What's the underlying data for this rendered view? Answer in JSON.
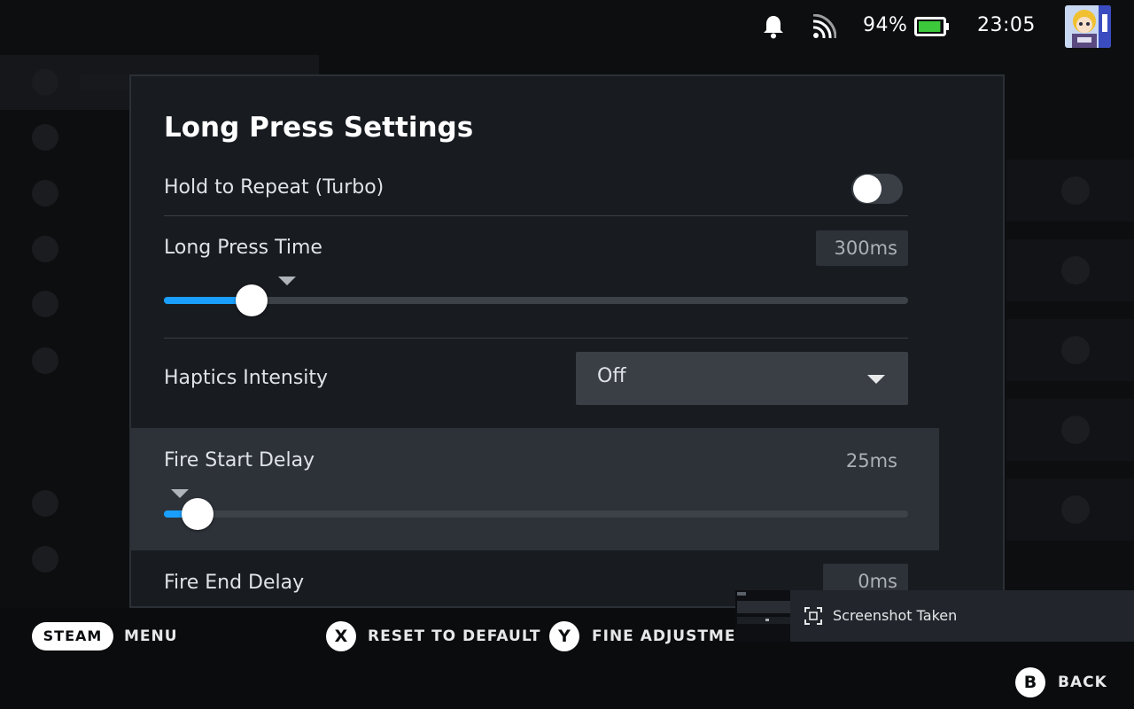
{
  "status_bar": {
    "battery_percent": "94%",
    "battery_level": 0.94,
    "time": "23:05",
    "icons": [
      "bell-icon",
      "wifi-icon",
      "battery-icon",
      "avatar"
    ]
  },
  "dialog": {
    "title": "Long Press Settings",
    "hold_to_repeat": {
      "label": "Hold to Repeat (Turbo)",
      "enabled": false
    },
    "long_press_time": {
      "label": "Long Press Time",
      "value": "300ms",
      "level": 0.118,
      "default_level": 0.165
    },
    "haptics": {
      "label": "Haptics Intensity",
      "selected": "Off"
    },
    "fire_start_delay": {
      "label": "Fire Start Delay",
      "value": "25ms",
      "level": 0.045,
      "default_level": 0.022
    },
    "fire_end_delay": {
      "label": "Fire End Delay",
      "value": "0ms"
    }
  },
  "footer": {
    "steam": "STEAM",
    "menu": "MENU",
    "x_button": "X",
    "reset": "RESET TO DEFAULT",
    "y_button": "Y",
    "fine": "FINE ADJUSTMEN",
    "b_button": "B",
    "back": "BACK"
  },
  "toast": {
    "text": "Screenshot Taken"
  },
  "colors": {
    "accent": "#1a9fff",
    "battery": "#3cc93c",
    "highlight": "#2d3239"
  }
}
